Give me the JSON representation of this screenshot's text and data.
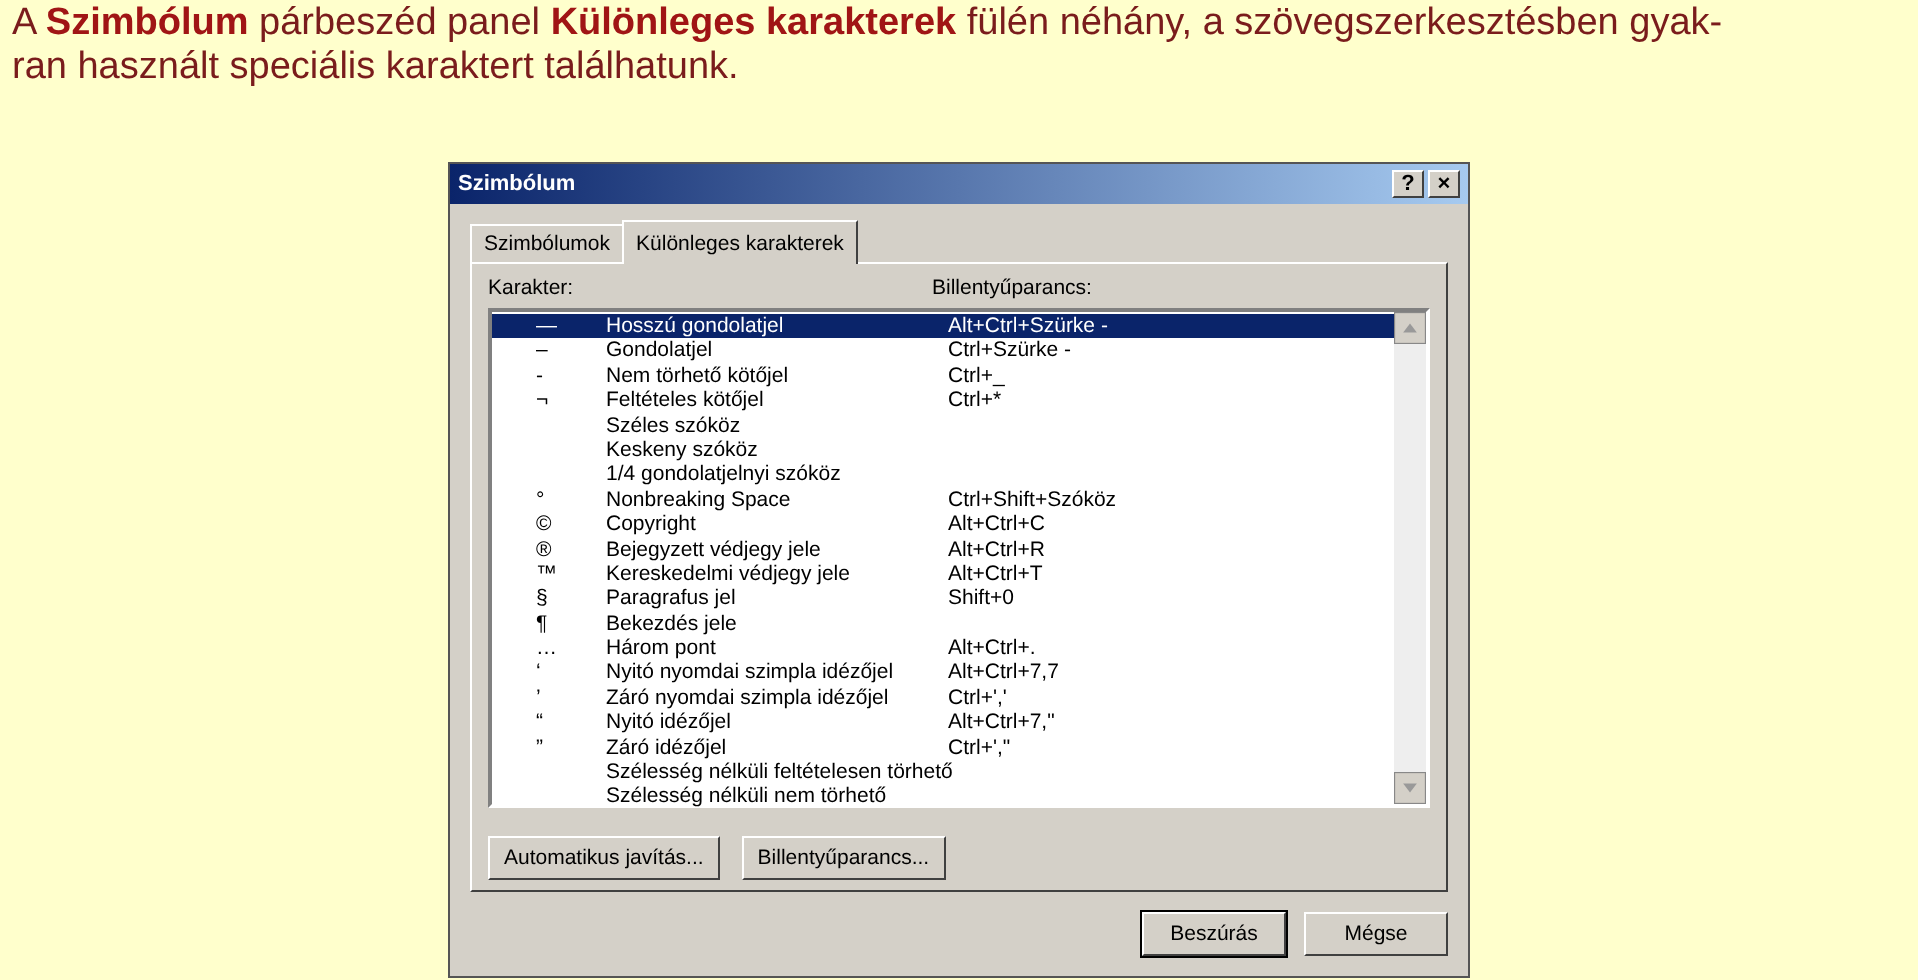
{
  "caption_lines": [
    "A **Szimbólum** párbeszéd panel **Különleges karakterek** fülén néhány, a szövegszerkesztésben gyak-",
    "ran használt speciális karaktert találhatunk."
  ],
  "window": {
    "title": "Szimbólum",
    "help": "?",
    "close": "×"
  },
  "tabs": [
    {
      "label": "Szimbólumok",
      "selected": false
    },
    {
      "label": "Különleges karakterek",
      "selected": true
    }
  ],
  "columns": [
    "Karakter:",
    "Billentyűparancs:"
  ],
  "rows": [
    {
      "char": "—",
      "name": "Hosszú gondolatjel",
      "shortcut": "Alt+Ctrl+Szürke -",
      "selected": true
    },
    {
      "char": "–",
      "name": "Gondolatjel",
      "shortcut": "Ctrl+Szürke -",
      "selected": false
    },
    {
      "char": "-",
      "name": "Nem törhető kötőjel",
      "shortcut": "Ctrl+_",
      "selected": false
    },
    {
      "char": "¬",
      "name": "Feltételes kötőjel",
      "shortcut": "Ctrl+*",
      "selected": false
    },
    {
      "name": "Széles szóköz",
      "selected": false
    },
    {
      "name": "Keskeny szóköz",
      "selected": false
    },
    {
      "name": "1/4 gondolatjelnyi szóköz",
      "selected": false
    },
    {
      "char": "°",
      "name": "Nonbreaking Space",
      "shortcut": "Ctrl+Shift+Szóköz",
      "selected": false
    },
    {
      "char": "©",
      "name": "Copyright",
      "shortcut": "Alt+Ctrl+C",
      "selected": false
    },
    {
      "char": "®",
      "name": "Bejegyzett védjegy jele",
      "shortcut": "Alt+Ctrl+R",
      "selected": false
    },
    {
      "char": "™",
      "name": "Kereskedelmi védjegy jele",
      "shortcut": "Alt+Ctrl+T",
      "selected": false
    },
    {
      "char": "§",
      "name": "Paragrafus jel",
      "shortcut": "Shift+0",
      "selected": false
    },
    {
      "char": "¶",
      "name": "Bekezdés jele",
      "selected": false
    },
    {
      "char": "…",
      "name": "Három pont",
      "shortcut": "Alt+Ctrl+.",
      "selected": false
    },
    {
      "char": "‘",
      "name": "Nyitó nyomdai szimpla idézőjel",
      "shortcut": "Alt+Ctrl+7,7",
      "selected": false
    },
    {
      "char": "’",
      "name": "Záró nyomdai szimpla idézőjel",
      "shortcut": "Ctrl+','",
      "selected": false
    },
    {
      "char": "“",
      "name": "Nyitó idézőjel",
      "shortcut": "Alt+Ctrl+7,\"",
      "selected": false
    },
    {
      "char": "”",
      "name": "Záró idézőjel",
      "shortcut": "Ctrl+',\"",
      "selected": false
    },
    {
      "name": "Szélesség nélküli feltételesen törhető",
      "selected": false
    },
    {
      "name": "Szélesség nélküli nem törhető",
      "selected": false
    }
  ],
  "panel_buttons": [
    "Automatikus javítás...",
    "Billentyűparancs..."
  ],
  "dialog_buttons": [
    {
      "label": "Beszúrás",
      "default": true
    },
    {
      "label": "Mégse",
      "default": false
    }
  ]
}
